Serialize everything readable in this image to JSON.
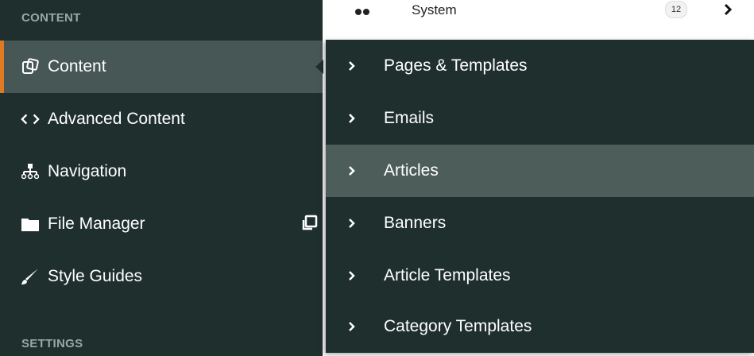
{
  "sidebar": {
    "section_content": "CONTENT",
    "section_settings": "SETTINGS",
    "items": [
      {
        "label": "Content",
        "icon": "content-icon",
        "active": true
      },
      {
        "label": "Advanced Content",
        "icon": "code-icon"
      },
      {
        "label": "Navigation",
        "icon": "sitemap-icon"
      },
      {
        "label": "File Manager",
        "icon": "folder-icon",
        "external_icon": "external-link-icon"
      },
      {
        "label": "Style Guides",
        "icon": "brush-icon"
      }
    ]
  },
  "background": {
    "system_label": "System",
    "system_count": "12"
  },
  "flyout": {
    "items": [
      {
        "label": "Pages & Templates"
      },
      {
        "label": "Emails"
      },
      {
        "label": "Articles",
        "hover": true
      },
      {
        "label": "Banners"
      },
      {
        "label": "Article Templates"
      },
      {
        "label": "Category Templates"
      }
    ]
  },
  "colors": {
    "sidebar_bg": "#1f2f2e",
    "active_bg": "#475755",
    "hover_bg": "#4c5d5a",
    "accent": "#e07a22"
  }
}
